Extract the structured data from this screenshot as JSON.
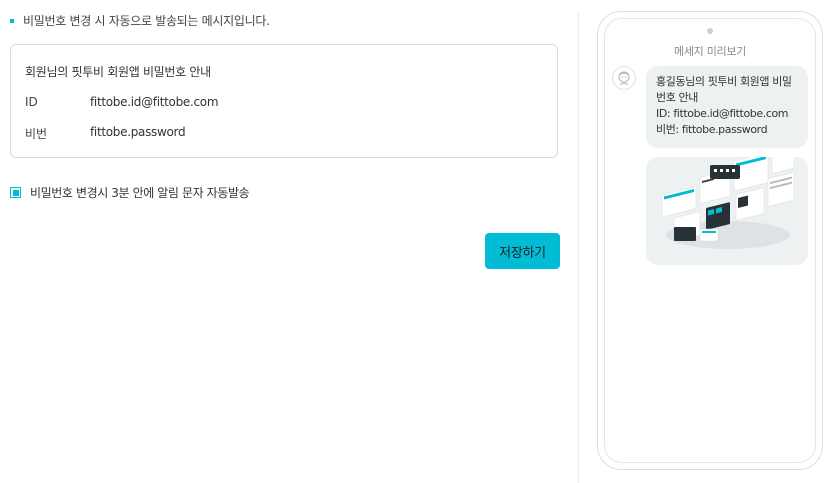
{
  "notice": {
    "text": "비밀번호 변경 시 자동으로 발송되는 메시지입니다."
  },
  "template": {
    "title": "회원님의 핏투비 회원앱 비밀번호 안내",
    "rows": [
      {
        "label": "ID",
        "value": "fittobe.id@fittobe.com"
      },
      {
        "label": "비번",
        "value": "fittobe.password"
      }
    ]
  },
  "auto_send": {
    "label": "비밀번호 변경시 3분 안에 알림 문자 자동발송",
    "checked": true
  },
  "save_button": {
    "label": "저장하기"
  },
  "preview": {
    "title": "메세지 미리보기",
    "bubble_lines": [
      "홍길동님의 핏투비 회원앱 비밀번호 안내",
      "ID: fittobe.id@fittobe.com",
      "비번: fittobe.password"
    ],
    "image_icon": "app-screens-collage"
  },
  "colors": {
    "accent": "#00bcd4",
    "bubble_bg": "#eef1f2",
    "border": "#d9d9d9"
  }
}
